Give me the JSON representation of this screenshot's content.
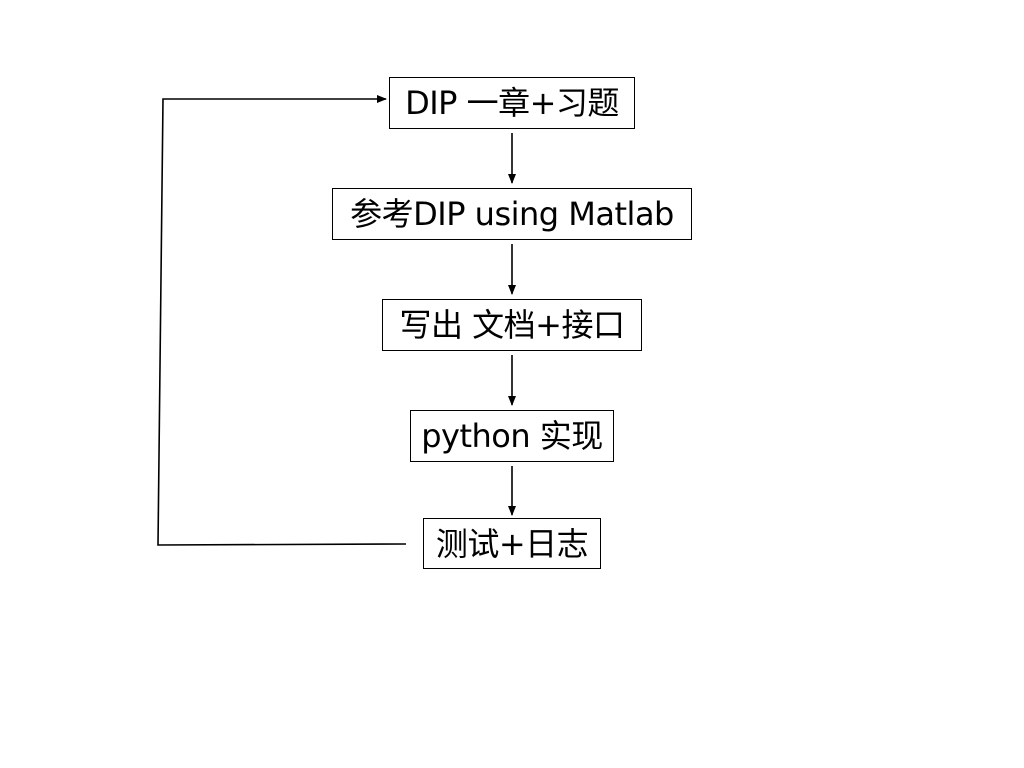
{
  "diagram": {
    "nodes": [
      {
        "id": "dip-chapter",
        "label": "DIP 一章+习题"
      },
      {
        "id": "reference-matlab",
        "label": "参考DIP using Matlab"
      },
      {
        "id": "write-docs",
        "label": "写出 文档+接口"
      },
      {
        "id": "python-impl",
        "label": "python 实现"
      },
      {
        "id": "test-log",
        "label": "测试+日志"
      }
    ],
    "edges": [
      {
        "from": "dip-chapter",
        "to": "reference-matlab"
      },
      {
        "from": "reference-matlab",
        "to": "write-docs"
      },
      {
        "from": "write-docs",
        "to": "python-impl"
      },
      {
        "from": "python-impl",
        "to": "test-log"
      },
      {
        "from": "test-log",
        "to": "dip-chapter",
        "type": "loop-back"
      }
    ],
    "colors": {
      "line": "#000000",
      "box_border": "#000000",
      "background": "#ffffff"
    }
  }
}
